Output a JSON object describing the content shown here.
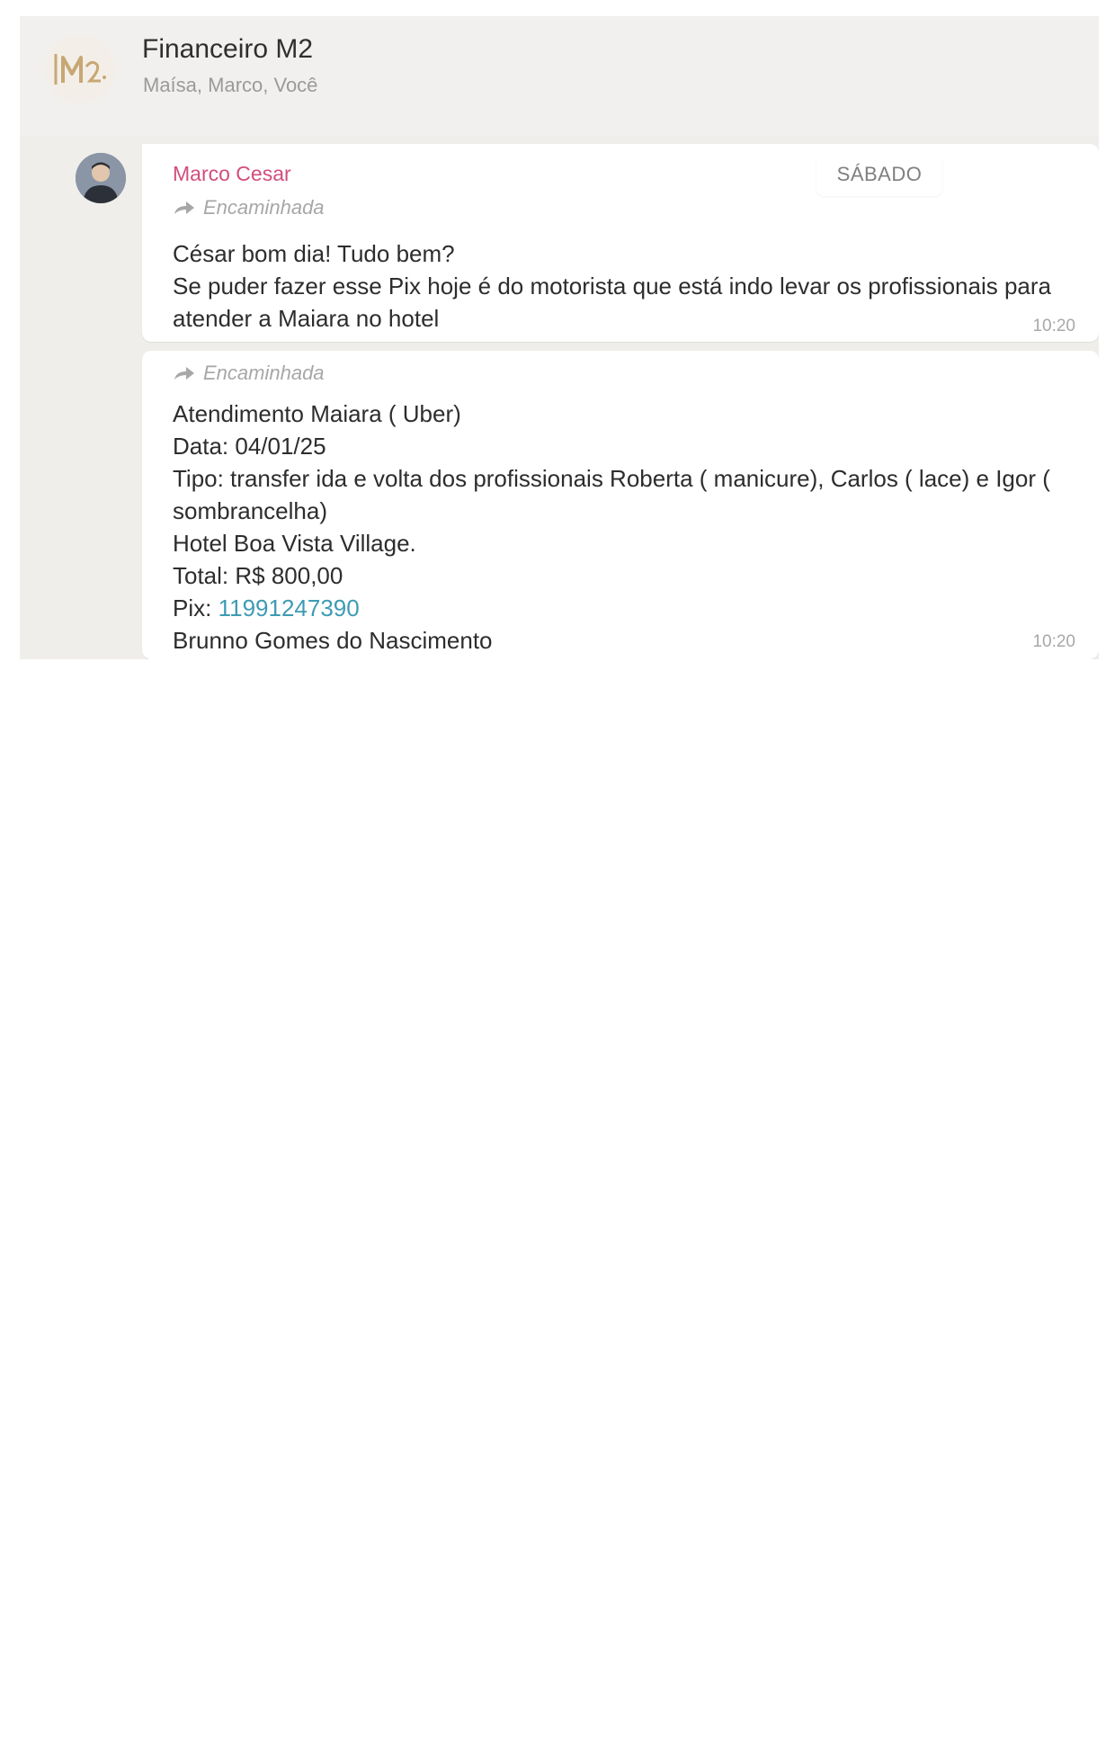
{
  "header": {
    "group_name": "Financeiro M2",
    "members": "Maísa, Marco, Você",
    "avatar_icon": "m2-logo-icon"
  },
  "date_separator": "SÁBADO",
  "messages": [
    {
      "sender": "Marco Cesar",
      "forwarded_label": "Encaminhada",
      "lines": [
        "César bom dia! Tudo bem?",
        "Se puder fazer esse Pix hoje é do motorista que está indo levar os profissionais para atender a Maiara no hotel"
      ],
      "time": "10:20"
    },
    {
      "forwarded_label": "Encaminhada",
      "lines": [
        "Atendimento Maiara ( Uber)",
        "Data: 04/01/25",
        "Tipo: transfer ida e volta dos profissionais Roberta ( manicure), Carlos ( lace) e Igor ( sombrancelha)",
        "Hotel Boa Vista Village.",
        "Total: R$ 800,00"
      ],
      "pix_label": "Pix: ",
      "pix_number": "11991247390",
      "last_line": "Brunno Gomes do Nascimento",
      "time": "10:20"
    }
  ],
  "colors": {
    "sender_name": "#d24d7d",
    "link": "#3d9bb3",
    "chat_background": "#efeeea"
  }
}
